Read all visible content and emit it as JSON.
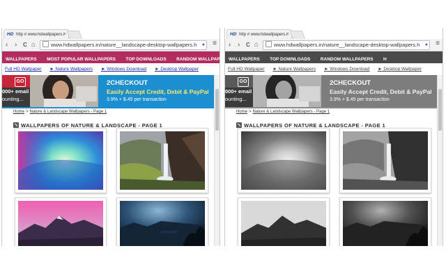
{
  "browser": {
    "tab_favicon": "HD",
    "tab_title": "http # www.hdwallpapers.i",
    "tab_close": "×",
    "back_icon": "‹",
    "forward_icon": "›",
    "reload_icon": "C",
    "home_icon": "⌂",
    "url": "www.hdwallpapers.in/nature__landscape-desktop-wallpapers.h",
    "ext_icon": "●",
    "menu_icon": "≡"
  },
  "site": {
    "nav": [
      "WALLPAPERS",
      "MOST POPULAR WALLPAPERS",
      "TOP DOWNLOADS",
      "RANDOM WALLPAPERS"
    ],
    "nav_right": [
      "WALLPAPERS",
      "TOP DOWNLOADS",
      "RANDOM WALLPAPERS"
    ],
    "right_nav_extra": "H",
    "sub_links": [
      "Full HD Wallpaper",
      "► Nature Wallpapers",
      "► Windows Download",
      "► Desktop Wallpaper"
    ],
    "ad": {
      "go_label": "GO",
      "email_text": "000+ email",
      "count_text": "ounting...",
      "brand": "2CHECKOUT",
      "headline": "Easily Accept Credit, Debit & PayPal",
      "price": "3.9% + $.45 per transaction"
    },
    "breadcrumb": {
      "home": "Home",
      "separator": ">",
      "link": "Nature & Landscape Wallpapers - Page 1"
    },
    "heading": "WALLPAPERS OF NATURE & LANDSCAPE - PAGE 1"
  },
  "colors": {
    "nav_bg_color": "#b12d5e",
    "nav_bg_gray": "#4a4a4a",
    "ad_blue": "#1b8fcf",
    "ad_gray": "#7d7d7d",
    "ad_red": "#c8253b",
    "ad_headline_color": "#ffe866",
    "ad_underline_color": "#1b8fcf",
    "link_color": "#1a2ea8",
    "link_gray": "#444444"
  }
}
